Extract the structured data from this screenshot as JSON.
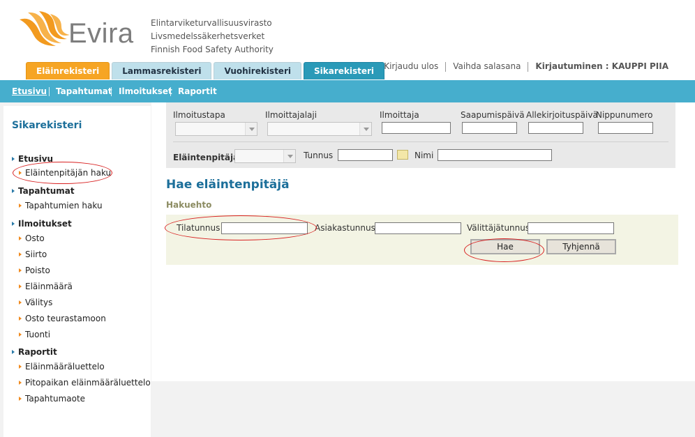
{
  "brand": {
    "logo_text": "Evira",
    "org_lines": [
      "Elintarviketurvallisuusvirasto",
      "Livsmedelssäkerhetsverket",
      "Finnish Food Safety Authority"
    ],
    "colors": {
      "orange": "#f6a524",
      "blue": "#2a9ab8",
      "menu": "#46aecd",
      "title": "#1c6f9a"
    }
  },
  "tabs": [
    {
      "label": "Eläinrekisteri"
    },
    {
      "label": "Lammasrekisteri"
    },
    {
      "label": "Vuohirekisteri"
    },
    {
      "label": "Sikarekisteri"
    }
  ],
  "toplinks": {
    "logout": "Kirjaudu ulos",
    "change_password": "Vaihda salasana",
    "login_info": "Kirjautuminen : KAUPPI PIIA"
  },
  "menu": [
    {
      "label": "Etusivu"
    },
    {
      "label": "Tapahtumat"
    },
    {
      "label": "Ilmoitukset"
    },
    {
      "label": "Raportit"
    }
  ],
  "sidebar": {
    "title": "Sikarekisteri",
    "groups": [
      {
        "label": "Etusivu",
        "items": [
          "Eläintenpitäjän haku"
        ]
      },
      {
        "label": "Tapahtumat",
        "items": [
          "Tapahtumien haku"
        ]
      },
      {
        "label": "Ilmoitukset",
        "items": [
          "Osto",
          "Siirto",
          "Poisto",
          "Eläinmäärä",
          "Välitys",
          "Osto teurastamoon",
          "Tuonti"
        ]
      },
      {
        "label": "Raportit",
        "items": [
          "Eläinmääräluettelo",
          "Pitopaikan eläinmääräluettelo",
          "Tapahtumaote"
        ]
      }
    ]
  },
  "filters": {
    "ilmoitustapa": "Ilmoitustapa",
    "ilmoittajalaji": "Ilmoittajalaji",
    "ilmoittaja": "Ilmoittaja",
    "saapumispaiva": "Saapumispäivä",
    "allekirjoituspaiva": "Allekirjoituspäivä",
    "nippunumero": "Nippunumero",
    "elaintenpitaja": "Eläintenpitäjä :",
    "tunnus": "Tunnus",
    "nimi": "Nimi"
  },
  "main": {
    "heading": "Hae eläintenpitäjä",
    "subheading": "Hakuehto",
    "fields": {
      "tilatunnus": "Tilatunnus",
      "asiakastunnus": "Asiakastunnus",
      "valittajatunnus": "Välittäjätunnus"
    },
    "buttons": {
      "search": "Hae",
      "clear": "Tyhjennä"
    }
  }
}
